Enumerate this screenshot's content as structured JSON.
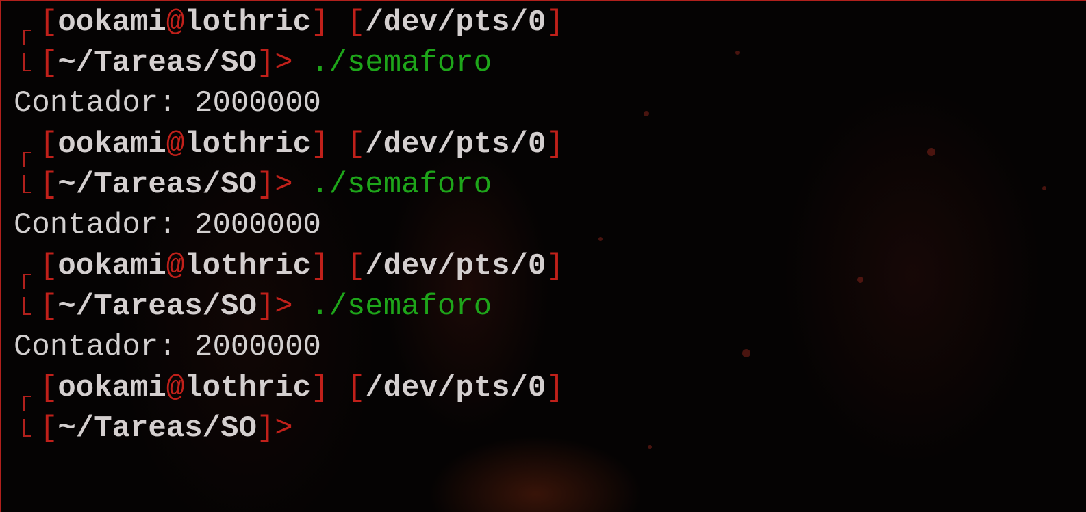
{
  "prompt": {
    "open_bracket": "[",
    "close_bracket": "]",
    "user": "ookami",
    "at": "@",
    "host": "lothric",
    "tty": "/dev/pts/0",
    "cwd": "~/Tareas/SO",
    "arrow": ">"
  },
  "entries": [
    {
      "command": "./semaforo",
      "output": "Contador: 2000000"
    },
    {
      "command": "./semaforo",
      "output": "Contador: 2000000"
    },
    {
      "command": "./semaforo",
      "output": "Contador: 2000000"
    },
    {
      "command": "",
      "output": ""
    }
  ],
  "colors": {
    "prompt_accent": "#c0201a",
    "prompt_text": "#d4cfcf",
    "command": "#1ea51a",
    "output": "#d2cfcf",
    "background": "#050303"
  }
}
